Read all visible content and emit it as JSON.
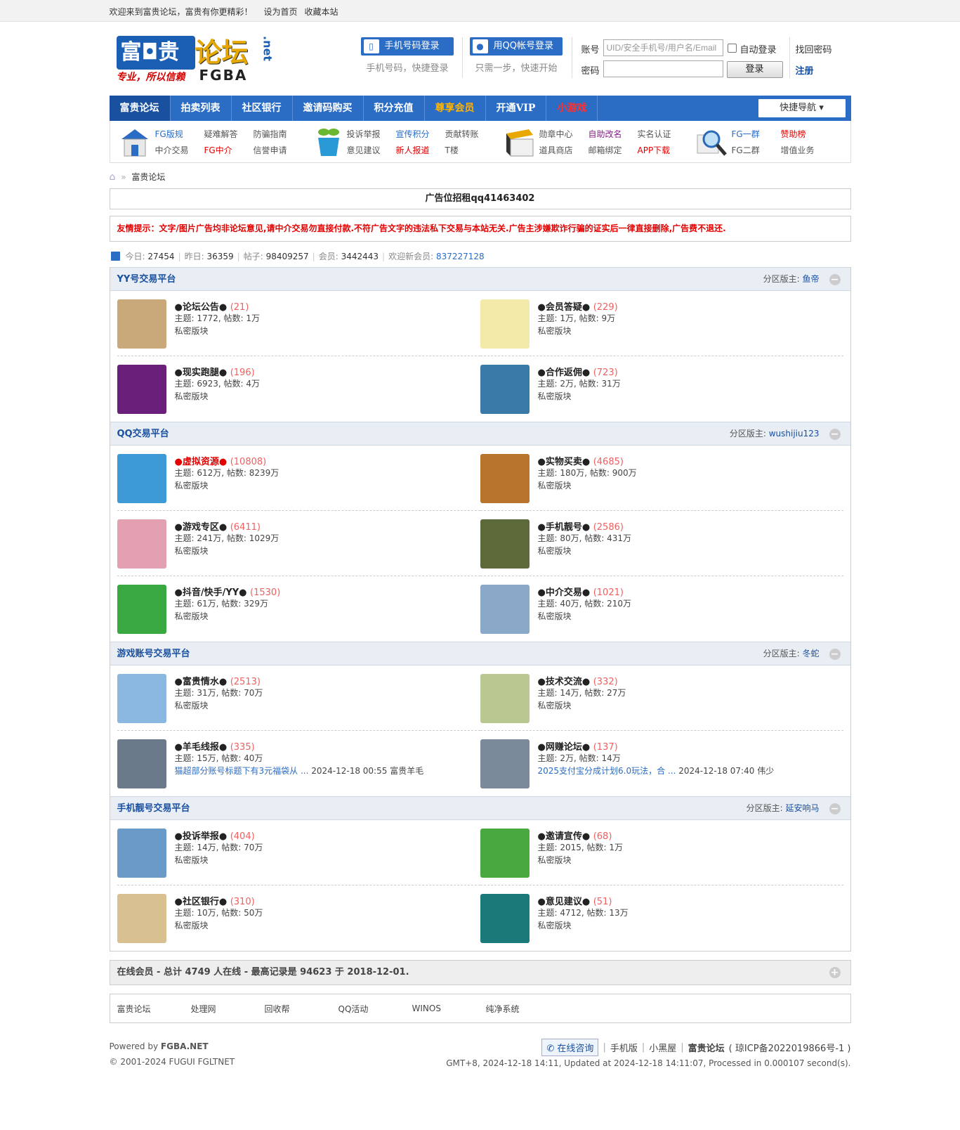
{
  "topbar": {
    "welcome": "欢迎来到富贵论坛，富贵有你更精彩！",
    "set_home": "设为首页",
    "bookmark": "收藏本站"
  },
  "logo": {
    "cn1": "富◘贵",
    "cn2": "论坛",
    "slogan": "专业，所以信赖",
    "en": "FGBA",
    "net": ".net"
  },
  "login": {
    "phone_btn": "手机号码登录",
    "phone_sub": "手机号码，快捷登录",
    "qq_btn": "用QQ帐号登录",
    "qq_sub": "只需一步，快速开始",
    "account_label": "账号",
    "account_placeholder": "UID/安全手机号/用户名/Email",
    "password_label": "密码",
    "auto_login": "自动登录",
    "login_btn": "登录",
    "forgot": "找回密码",
    "register": "注册"
  },
  "nav": {
    "items": [
      "富贵论坛",
      "拍卖列表",
      "社区银行",
      "邀请码购买",
      "积分充值",
      "尊享会员",
      "开通VIP",
      "小游戏"
    ],
    "quick": "快捷导航"
  },
  "subnav": {
    "g1": [
      [
        "FG版规",
        "疑难解答",
        "防骗指南"
      ],
      [
        "中介交易",
        "FG中介",
        "信誉申请"
      ]
    ],
    "g2": [
      [
        "投诉举报",
        "宣传积分",
        "贡献转账"
      ],
      [
        "意见建议",
        "新人报道",
        "T楼"
      ]
    ],
    "g3": [
      [
        "勋章中心",
        "自助改名",
        "实名认证"
      ],
      [
        "道具商店",
        "邮箱绑定",
        "APP下载"
      ]
    ],
    "g4": [
      [
        "FG一群",
        "赞助榜"
      ],
      [
        "FG二群",
        "增值业务"
      ]
    ]
  },
  "crumb": {
    "home_icon": "home-icon",
    "sep": "»",
    "current": "富贵论坛"
  },
  "ad": {
    "text": "广告位招租qq41463402"
  },
  "notice": {
    "text": "友情提示：文字/图片广告均非论坛意见,请中介交易勿直接付款.不符广告文字的违法私下交易与本站无关.广告主涉嫌欺诈行骗的证实后一律直接删除,广告费不退还."
  },
  "stats": {
    "today_label": "今日:",
    "today": "27454",
    "yesterday_label": "昨日:",
    "yesterday": "36359",
    "posts_label": "帖子:",
    "posts": "98409257",
    "members_label": "会员:",
    "members": "3442443",
    "newest_label": "欢迎新会员:",
    "newest": "837227128"
  },
  "sections": [
    {
      "title": "YY号交易平台",
      "mod_label": "分区版主:",
      "mod": "鱼帝",
      "forums": [
        {
          "name": "●论坛公告●",
          "count": "(21)",
          "stat": "主题: 1772, 帖数: 1万",
          "info": "私密版块",
          "color": "#c9a97a"
        },
        {
          "name": "●会员答疑●",
          "count": "(229)",
          "stat": "主题: 1万, 帖数: 9万",
          "info": "私密版块",
          "color": "#f3e9a8"
        },
        {
          "name": "●现实跑腿●",
          "count": "(196)",
          "stat": "主题: 6923, 帖数: 4万",
          "info": "私密版块",
          "color": "#6a1f7a"
        },
        {
          "name": "●合作返佣●",
          "count": "(723)",
          "stat": "主题: 2万, 帖数: 31万",
          "info": "私密版块",
          "color": "#3a7aa8"
        }
      ]
    },
    {
      "title": "QQ交易平台",
      "mod_label": "分区版主:",
      "mod": "wushijiu123",
      "forums": [
        {
          "name": "●虚拟资源●",
          "count": "(10808)",
          "stat": "主题: 612万, 帖数: 8239万",
          "info": "私密版块",
          "color": "#3d9ad6",
          "red": true
        },
        {
          "name": "●实物买卖●",
          "count": "(4685)",
          "stat": "主题: 180万, 帖数: 900万",
          "info": "私密版块",
          "color": "#b8742a"
        },
        {
          "name": "●游戏专区●",
          "count": "(6411)",
          "stat": "主题: 241万, 帖数: 1029万",
          "info": "私密版块",
          "color": "#e2a0b0"
        },
        {
          "name": "●手机靓号●",
          "count": "(2586)",
          "stat": "主题: 80万, 帖数: 431万",
          "info": "私密版块",
          "color": "#5c6a3a"
        },
        {
          "name": "●抖音/快手/YY●",
          "count": "(1530)",
          "stat": "主题: 61万, 帖数: 329万",
          "info": "私密版块",
          "color": "#3aa840"
        },
        {
          "name": "●中介交易●",
          "count": "(1021)",
          "stat": "主题: 40万, 帖数: 210万",
          "info": "私密版块",
          "color": "#8aa8c8"
        }
      ]
    },
    {
      "title": "游戏账号交易平台",
      "mod_label": "分区版主:",
      "mod": "冬蛇",
      "forums": [
        {
          "name": "●富贵情水●",
          "count": "(2513)",
          "stat": "主题: 31万, 帖数: 70万",
          "info": "私密版块",
          "color": "#8ab8e0"
        },
        {
          "name": "●技术交流●",
          "count": "(332)",
          "stat": "主题: 14万, 帖数: 27万",
          "info": "私密版块",
          "color": "#b8c890"
        },
        {
          "name": "●羊毛线报●",
          "count": "(335)",
          "stat": "主题: 15万, 帖数: 40万",
          "last_link": "猫超部分账号标题下有3元福袋从 ...",
          "last_time": "2024-12-18 00:55",
          "last_user": "富贵羊毛",
          "color": "#6a7a8a"
        },
        {
          "name": "●网赚论坛●",
          "count": "(137)",
          "stat": "主题: 2万, 帖数: 14万",
          "last_link": "2025支付宝分成计划6.0玩法，合 ...",
          "last_time": "2024-12-18 07:40",
          "last_user": "伟少",
          "color": "#7a8a9a"
        }
      ]
    },
    {
      "title": "手机靓号交易平台",
      "mod_label": "分区版主:",
      "mod": "延安响马",
      "forums": [
        {
          "name": "●投诉举报●",
          "count": "(404)",
          "stat": "主题: 14万, 帖数: 70万",
          "info": "私密版块",
          "color": "#6a9ac8"
        },
        {
          "name": "●邀请宣传●",
          "count": "(68)",
          "stat": "主题: 2015, 帖数: 1万",
          "info": "私密版块",
          "color": "#4aa840"
        },
        {
          "name": "●社区银行●",
          "count": "(310)",
          "stat": "主题: 10万, 帖数: 50万",
          "info": "私密版块",
          "color": "#d8c090"
        },
        {
          "name": "●意见建议●",
          "count": "(51)",
          "stat": "主题: 4712, 帖数: 13万",
          "info": "私密版块",
          "color": "#1a7a7a"
        }
      ]
    }
  ],
  "online": {
    "text": "在线会员 - 总计 4749 人在线 - 最高记录是 94623 于 2018-12-01."
  },
  "links": [
    "富贵论坛",
    "处理网",
    "回收帮",
    "QQ活动",
    "WINOS",
    "纯净系统"
  ],
  "footer": {
    "powered": "Powered by",
    "brand": "FGBA.NET",
    "copy": "© 2001-2024 FUGUI FGLTNET",
    "consult": "在线咨询",
    "mobile": "手机版",
    "blackhouse": "小黑屋",
    "site": "富贵论坛",
    "icp": "( 琼ICP备2022019866号-1 )",
    "runtime": "GMT+8, 2024-12-18 14:11, Updated at 2024-12-18 14:11:07, Processed in 0.000107 second(s)."
  }
}
